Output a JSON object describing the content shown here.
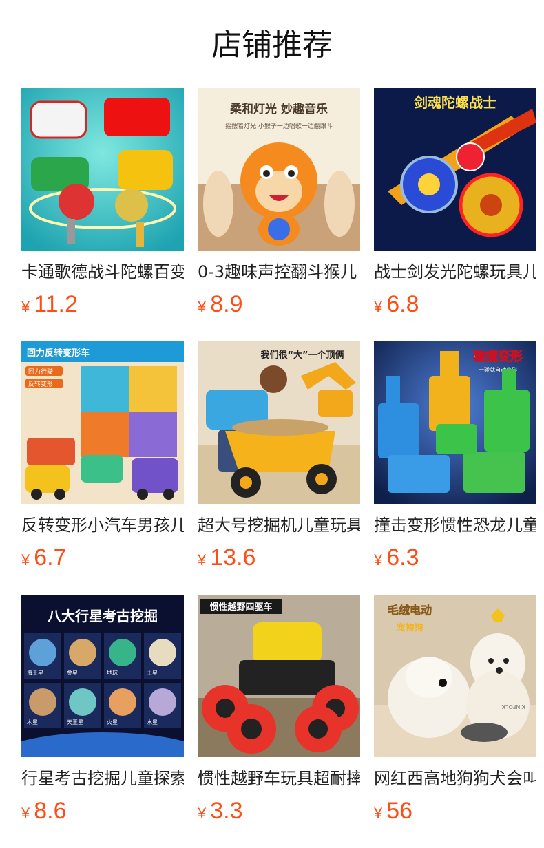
{
  "section_title": "店铺推荐",
  "currency_symbol": "¥",
  "accent_color": "#ff4d15",
  "products": [
    {
      "name": "卡通歌德战斗陀螺百变",
      "price": "11.2",
      "image_text": ""
    },
    {
      "name": "0-3趣味声控翻斗猴儿",
      "price": "8.9",
      "image_text": "柔和灯光 妙趣音乐",
      "image_subtext": "摇摆着灯光 小猴子一边唱歌一边翻跟斗"
    },
    {
      "name": "战士剑发光陀螺玩具儿",
      "price": "6.8",
      "image_text": "剑魂陀螺战士"
    },
    {
      "name": "反转变形小汽车男孩儿",
      "price": "6.7",
      "image_text": "回力反转变形车",
      "image_tags": [
        "回力行驶",
        "反转变形"
      ]
    },
    {
      "name": "超大号挖掘机儿童玩具",
      "price": "13.6",
      "image_text": "我们很“大”一个顶俩"
    },
    {
      "name": "撞击变形惯性恐龙儿童",
      "price": "6.3",
      "image_text": "碰撞变形",
      "image_subtext": "一碰就自动变形"
    },
    {
      "name": "行星考古挖掘儿童探索",
      "price": "8.6",
      "image_text": "八大行星考古挖掘",
      "planet_labels": [
        "海王星",
        "金星",
        "地球",
        "土星",
        "木星",
        "天王星",
        "火星",
        "水星"
      ]
    },
    {
      "name": "惯性越野车玩具超耐摔",
      "price": "3.3",
      "image_text": "惯性越野四驱车"
    },
    {
      "name": "网红西高地狗狗犬会叫",
      "price": "56",
      "image_text": "毛绒电动",
      "image_subtext": "宠物狗",
      "image_brand": "KINFOLK"
    }
  ]
}
